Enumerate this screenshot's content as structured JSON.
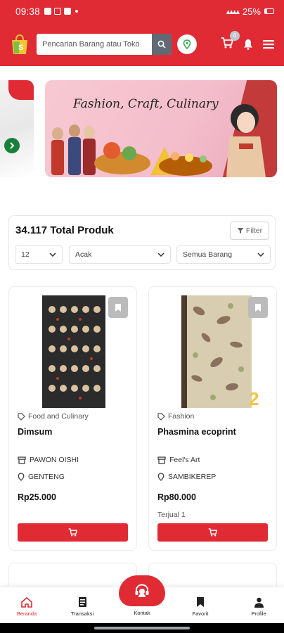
{
  "status_bar": {
    "time": "09:38",
    "battery": "25%"
  },
  "header": {
    "search_placeholder": "Pencarian Barang atau Toko",
    "cart_count": "0",
    "colors": {
      "brand_red": "#e02b35",
      "search_button": "#5f6a75"
    }
  },
  "banner": {
    "title": "Fashion, Craft, Culinary"
  },
  "products_panel": {
    "total_label": "34.117 Total Produk",
    "filter_label": "Filter",
    "per_page_value": "12",
    "sort_value": "Acak",
    "category_value": "Semua Barang"
  },
  "products": [
    {
      "category": "Food and Culinary",
      "name": "Dimsum",
      "store": "PAWON OISHI",
      "location": "GENTENG",
      "price": "Rp25.000",
      "sold": ""
    },
    {
      "category": "Fashion",
      "name": "Phasmina ecoprint",
      "store": "Feel's Art",
      "location": "SAMBIKEREP",
      "price": "Rp80.000",
      "sold": "Terjual 1",
      "image_badge": "2"
    }
  ],
  "bottom_nav": {
    "items": [
      {
        "label": "Beranda",
        "icon": "home-icon",
        "active": true
      },
      {
        "label": "Transaksi",
        "icon": "receipt-icon",
        "active": false
      },
      {
        "label": "Kontak",
        "icon": "headset-icon",
        "active": false
      },
      {
        "label": "Favorit",
        "icon": "bookmark-icon",
        "active": false
      },
      {
        "label": "Profile",
        "icon": "user-icon",
        "active": false
      }
    ]
  }
}
